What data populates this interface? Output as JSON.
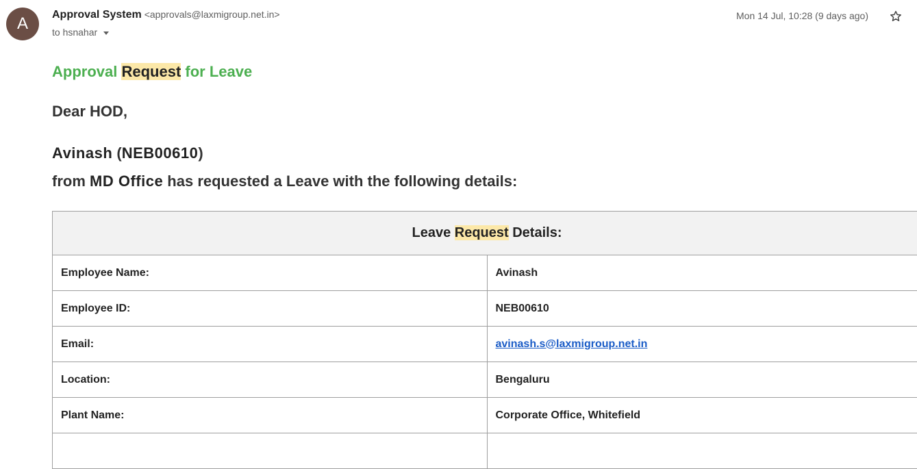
{
  "sender": {
    "avatar_letter": "A",
    "name": "Approval System",
    "email": "<approvals@laxmigroup.net.in>",
    "to": "to hsnahar",
    "date": "Mon 14 Jul, 10:28 (9 days ago)"
  },
  "colors": {
    "title": "#4caf50",
    "highlight": "#fce8a8",
    "link": "#1a5cc7",
    "avatar": "#6b4e45"
  },
  "icons": {
    "star": "star-icon",
    "caret": "chevron-down-icon"
  },
  "body": {
    "title_pre": "Approval ",
    "title_hl": "Request",
    "title_post": " for Leave",
    "greeting": "Dear HOD,",
    "emp_name": "Avinash",
    "emp_paren_open": " (",
    "emp_id": "NEB00610",
    "emp_paren_close": ")",
    "from_word": "from ",
    "dept": "MD Office",
    "request_text": " has requested a Leave with the following details:"
  },
  "table": {
    "header_pre": "Leave ",
    "header_hl": "Request",
    "header_post": " Details:",
    "rows": [
      {
        "label": "Employee Name:",
        "value": "Avinash"
      },
      {
        "label": "Employee ID:",
        "value": "NEB00610"
      },
      {
        "label": "Email:",
        "value": "avinash.s@laxmigroup.net.in"
      },
      {
        "label": "Location:",
        "value": "Bengaluru"
      },
      {
        "label": "Plant Name:",
        "value": "Corporate Office, Whitefield"
      },
      {
        "label": "",
        "value": ""
      }
    ]
  }
}
